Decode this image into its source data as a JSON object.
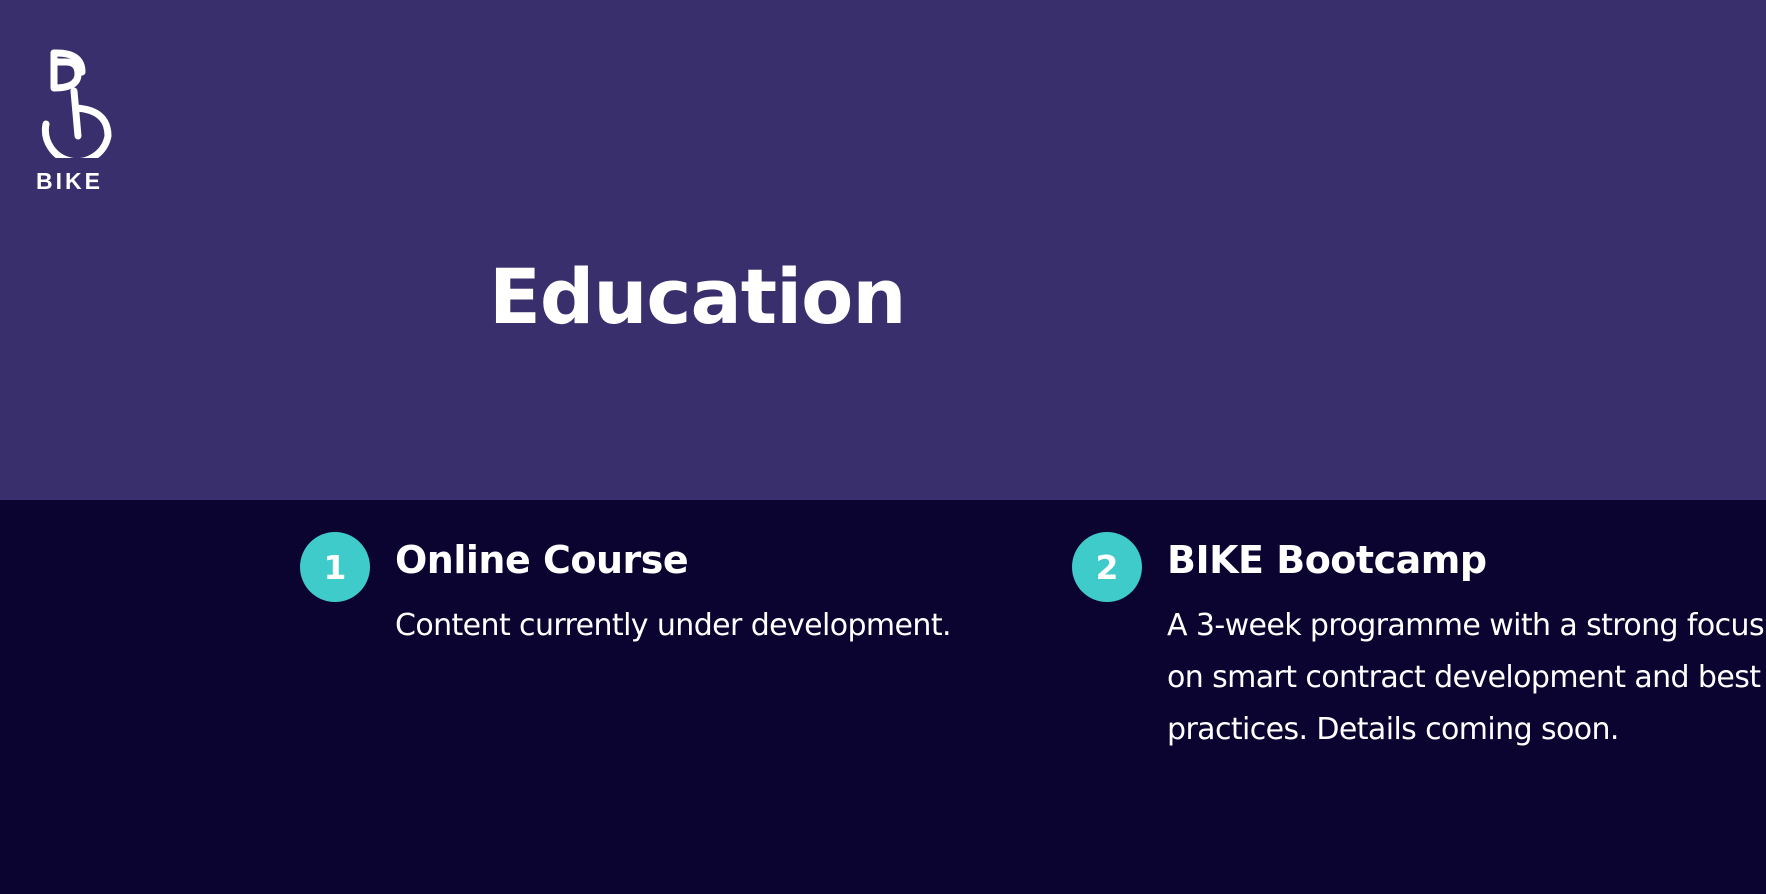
{
  "header": {
    "logo_text": "BIKE",
    "title": "Education"
  },
  "programs": [
    {
      "number": "1",
      "title": "Online Course",
      "description": "Content currently under development."
    },
    {
      "number": "2",
      "title": "BIKE Bootcamp",
      "description": "A 3-week programme with a strong focus on smart contract development and best practices. Details coming soon."
    }
  ],
  "colors": {
    "hero_background": "#3a2f6d",
    "page_background": "#0b0330",
    "accent": "#3ecbc9",
    "text": "#ffffff"
  },
  "icons": {
    "logo_mark": "bike-logo-icon"
  }
}
